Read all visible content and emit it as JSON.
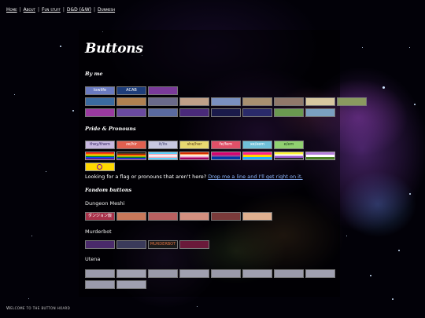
{
  "nav": {
    "items": [
      "Home",
      "About",
      "Fun stuff",
      "D&D (&W)",
      "Dunmesh"
    ],
    "separator": "|"
  },
  "page_title": "Buttons",
  "sections": {
    "by_me": "By me",
    "pride": "Pride & Pronouns",
    "fandom": "Fandom buttons"
  },
  "buttons_by_me": [
    {
      "text": "lowlife",
      "bg": "#6a7ac0",
      "fg": "#ffffff"
    },
    {
      "text": "ACAB",
      "bg": "#1e3d7a",
      "fg": "#ffffff"
    },
    {
      "text": "",
      "bg": "#7a3a9a",
      "fg": "#ffffff"
    },
    {
      "text": "",
      "bg": "#3a6aa0",
      "fg": "#ffffff"
    },
    {
      "text": "",
      "bg": "#b08050",
      "fg": "#ffffff"
    },
    {
      "text": "",
      "bg": "#6a6a8a",
      "fg": "#ffffff"
    },
    {
      "text": "",
      "bg": "#c0a088",
      "fg": "#ffffff"
    },
    {
      "text": "",
      "bg": "#7a90c0",
      "fg": "#ffffff"
    },
    {
      "text": "",
      "bg": "#a89070",
      "fg": "#ffffff"
    },
    {
      "text": "",
      "bg": "#90786a",
      "fg": "#ffffff"
    },
    {
      "text": "",
      "bg": "#d8c8a0",
      "fg": "#333333"
    },
    {
      "text": "",
      "bg": "#8a9a60",
      "fg": "#ffffff"
    },
    {
      "text": "",
      "bg": "#9a3aa0",
      "fg": "#ffffff"
    },
    {
      "text": "",
      "bg": "#6a4aa0",
      "fg": "#ffffff"
    },
    {
      "text": "",
      "bg": "#5a6aa0",
      "fg": "#ffffff"
    },
    {
      "text": "",
      "bg": "#4a2a7a",
      "fg": "#ffffff"
    },
    {
      "text": "",
      "bg": "#1a1a4a",
      "fg": "#ffffff"
    },
    {
      "text": "",
      "bg": "#2a2a6a",
      "fg": "#ffffff"
    },
    {
      "text": "",
      "bg": "#6a9a50",
      "fg": "#ffffff"
    },
    {
      "text": "",
      "bg": "#7aa0c0",
      "fg": "#ffffff"
    }
  ],
  "pronoun_buttons": [
    {
      "text": "they/them",
      "bg": "#c8b8e0",
      "fg": "#2a1a5a"
    },
    {
      "text": "ze/hir",
      "bg": "#e06050",
      "fg": "#ffffff"
    },
    {
      "text": "it/its",
      "bg": "#c8c8e0",
      "fg": "#3a3a6a"
    },
    {
      "text": "she/her",
      "bg": "#e8d870",
      "fg": "#5a3a1a"
    },
    {
      "text": "fe/fem",
      "bg": "#e05068",
      "fg": "#ffffff"
    },
    {
      "text": "xe/xem",
      "bg": "#70c0d8",
      "fg": "#ffffff"
    },
    {
      "text": "e/em",
      "bg": "#90d070",
      "fg": "#1a3a1a"
    }
  ],
  "flags": [
    {
      "stripes": [
        "#e40303",
        "#ff8c00",
        "#ffed00",
        "#008026",
        "#004dff",
        "#750787"
      ]
    },
    {
      "stripes": [
        "#000000",
        "#613915",
        "#e40303",
        "#ff8c00",
        "#ffed00",
        "#008026",
        "#004dff",
        "#750787"
      ]
    },
    {
      "stripes": [
        "#5bcefa",
        "#f5a9b8",
        "#ffffff",
        "#f5a9b8",
        "#5bcefa"
      ]
    },
    {
      "stripes": [
        "#d52d00",
        "#ff9a56",
        "#ffffff",
        "#d362a4",
        "#a30262"
      ]
    },
    {
      "stripes": [
        "#d60270",
        "#d60270",
        "#9b4f96",
        "#0038a8",
        "#0038a8"
      ]
    },
    {
      "stripes": [
        "#ff218c",
        "#ffd800",
        "#21b1ff"
      ]
    },
    {
      "stripes": [
        "#fcf434",
        "#ffffff",
        "#9c59d1",
        "#2c2c2c"
      ]
    },
    {
      "stripes": [
        "#b57edc",
        "#ffffff",
        "#4a8123"
      ]
    },
    {
      "stripes": [
        "#ffd800",
        "#ffd800",
        "#ffd800"
      ],
      "ring": "#7902aa"
    }
  ],
  "note": {
    "text": "Looking for a flag or pronouns that aren't here?",
    "link": "Drop me a line and I'll get right on it."
  },
  "fandoms": [
    {
      "name": "Dungeon Meshi",
      "buttons": [
        {
          "text": "ダンジョン飯",
          "bg": "#a8324a",
          "fg": "#ffffff"
        },
        {
          "text": "",
          "bg": "#c8785a",
          "fg": "#ffffff"
        },
        {
          "text": "",
          "bg": "#b86060",
          "fg": "#ffffff"
        },
        {
          "text": "",
          "bg": "#d49080",
          "fg": "#ffffff"
        },
        {
          "text": "",
          "bg": "#7a3a3a",
          "fg": "#ffffff"
        },
        {
          "text": "",
          "bg": "#e0b090",
          "fg": "#3a1a1a"
        }
      ]
    },
    {
      "name": "Murderbot",
      "buttons": [
        {
          "text": "",
          "bg": "#4a2a6a",
          "fg": "#ffffff"
        },
        {
          "text": "",
          "bg": "#3a3a5a",
          "fg": "#ffffff"
        },
        {
          "text": "MURDERBOT",
          "bg": "#1a1a1a",
          "fg": "#e07040"
        },
        {
          "text": "",
          "bg": "#6a1a3a",
          "fg": "#ffffff"
        }
      ]
    },
    {
      "name": "Utena",
      "buttons": [
        {
          "text": "",
          "bg": "#9a9aaa",
          "fg": "#ffffff"
        },
        {
          "text": "",
          "bg": "#a0a0b0",
          "fg": "#ffffff"
        },
        {
          "text": "",
          "bg": "#9a9aaa",
          "fg": "#ffffff"
        },
        {
          "text": "",
          "bg": "#a0a0b0",
          "fg": "#ffffff"
        },
        {
          "text": "",
          "bg": "#9a9aaa",
          "fg": "#ffffff"
        },
        {
          "text": "",
          "bg": "#a0a0b0",
          "fg": "#ffffff"
        },
        {
          "text": "",
          "bg": "#9a9aaa",
          "fg": "#ffffff"
        },
        {
          "text": "",
          "bg": "#a0a0b0",
          "fg": "#ffffff"
        },
        {
          "text": "",
          "bg": "#9a9aaa",
          "fg": "#ffffff"
        },
        {
          "text": "",
          "bg": "#a0a0b0",
          "fg": "#ffffff"
        }
      ]
    }
  ],
  "footer": "Welcome to the button hoard"
}
